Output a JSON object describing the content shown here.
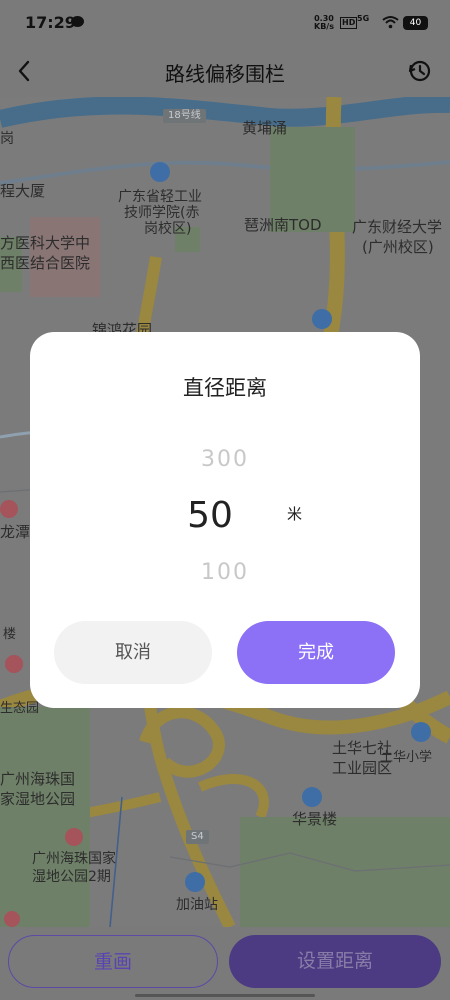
{
  "status_bar": {
    "time": "17:29",
    "speed": "0.30",
    "speed_unit": "KB/s",
    "hd": "HD",
    "network": "5G",
    "battery": "40"
  },
  "app_bar": {
    "title": "路线偏移围栏",
    "back_icon": "chevron-left-icon",
    "history_icon": "history-clock-icon"
  },
  "map": {
    "road_badges": [
      "18号线",
      "S4"
    ],
    "labels": [
      "黄埔涌",
      "广东省轻工业",
      "技师学院(赤",
      "岗校区)",
      "琶洲南TOD",
      "广东财经大学",
      "(广州校区)",
      "程大厦",
      "方医科大学中",
      "西医结合医院",
      "锦鸿花园",
      "龙潭",
      "土华七社",
      "工业园区",
      "土华小学",
      "华景楼",
      "广州海珠国家",
      "湿地公园2期",
      "加油站",
      "广州海珠国",
      "家湿地公园",
      "生态园",
      "岗",
      "楼"
    ]
  },
  "dialog": {
    "title": "直径距离",
    "picker_above": "300",
    "picker_selected": "50",
    "picker_below": "100",
    "unit": "米",
    "cancel_label": "取消",
    "done_label": "完成"
  },
  "bottom_bar": {
    "redraw_label": "重画",
    "set_distance_label": "设置距离"
  },
  "colors": {
    "accent": "#8c70f6",
    "overlay_map": "#7b7b7b",
    "road": "#9a8740",
    "water": "#476d8b"
  }
}
